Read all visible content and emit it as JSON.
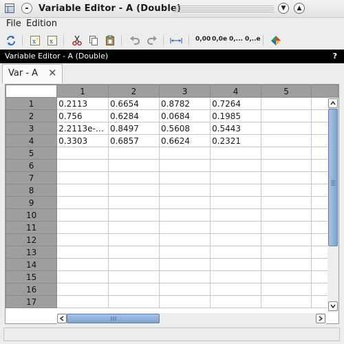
{
  "window": {
    "title": "Variable Editor - A  (Double)",
    "minimize_symbol": "▼",
    "maximize_symbol": "▲"
  },
  "menubar": {
    "items": [
      "File",
      "Edition"
    ]
  },
  "toolbar": {
    "icons": [
      "refresh-icon",
      "new-variable-icon",
      "edit-variable-icon",
      "cut-icon",
      "copy-icon",
      "paste-icon",
      "undo-icon",
      "redo-icon",
      "fit-columns-icon",
      "format-fixed-icon",
      "format-exponent-icon",
      "format-short-icon",
      "format-short-exp-icon",
      "plot-icon"
    ],
    "formats": [
      "0,00",
      "0,0e",
      "0,...",
      "0,..e"
    ]
  },
  "panel": {
    "title": "Variable Editor - A  (Double)",
    "help": "?"
  },
  "tabs": [
    {
      "label": "Var - A",
      "close": "✕"
    }
  ],
  "grid": {
    "columns": [
      "1",
      "2",
      "3",
      "4",
      "5"
    ],
    "rows": [
      {
        "label": "1",
        "cells": [
          "0.2113",
          "0.6654",
          "0.8782",
          "0.7264",
          ""
        ]
      },
      {
        "label": "2",
        "cells": [
          "0.756",
          "0.6284",
          "0.0684",
          "0.1985",
          ""
        ]
      },
      {
        "label": "3",
        "cells": [
          "2.2113e-…",
          "0.8497",
          "0.5608",
          "0.5443",
          ""
        ]
      },
      {
        "label": "4",
        "cells": [
          "0.3303",
          "0.6857",
          "0.6624",
          "0.2321",
          ""
        ]
      },
      {
        "label": "5",
        "cells": [
          "",
          "",
          "",
          "",
          ""
        ]
      },
      {
        "label": "6",
        "cells": [
          "",
          "",
          "",
          "",
          ""
        ]
      },
      {
        "label": "7",
        "cells": [
          "",
          "",
          "",
          "",
          ""
        ]
      },
      {
        "label": "8",
        "cells": [
          "",
          "",
          "",
          "",
          ""
        ]
      },
      {
        "label": "9",
        "cells": [
          "",
          "",
          "",
          "",
          ""
        ]
      },
      {
        "label": "10",
        "cells": [
          "",
          "",
          "",
          "",
          ""
        ]
      },
      {
        "label": "11",
        "cells": [
          "",
          "",
          "",
          "",
          ""
        ]
      },
      {
        "label": "12",
        "cells": [
          "",
          "",
          "",
          "",
          ""
        ]
      },
      {
        "label": "13",
        "cells": [
          "",
          "",
          "",
          "",
          ""
        ]
      },
      {
        "label": "14",
        "cells": [
          "",
          "",
          "",
          "",
          ""
        ]
      },
      {
        "label": "15",
        "cells": [
          "",
          "",
          "",
          "",
          ""
        ]
      },
      {
        "label": "16",
        "cells": [
          "",
          "",
          "",
          "",
          ""
        ]
      },
      {
        "label": "17",
        "cells": [
          "",
          "",
          "",
          "",
          ""
        ]
      }
    ]
  },
  "scrollbars": {
    "up": "▲",
    "down": "▼",
    "left": "◀",
    "right": "▶"
  },
  "colors": {
    "header_gray": "#9e9e9e",
    "scroll_thumb": "#7ea2cf",
    "panel_bar": "#000000"
  }
}
